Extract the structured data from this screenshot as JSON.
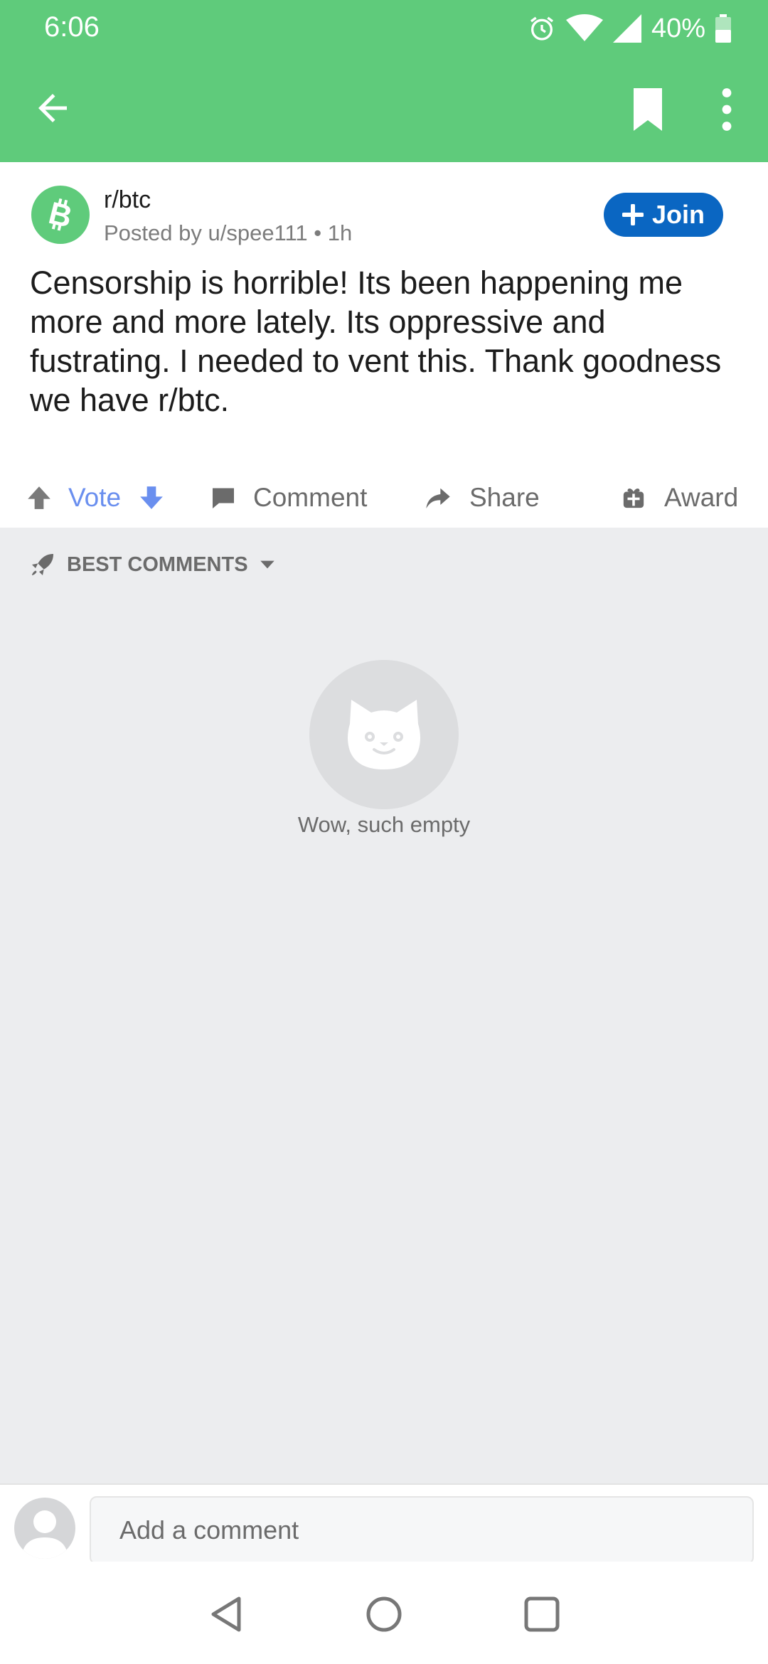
{
  "status_bar": {
    "time": "6:06",
    "battery": "40%",
    "icons": [
      "alarm-icon",
      "wifi-icon",
      "signal-icon",
      "battery-icon"
    ]
  },
  "app_bar": {
    "icons": [
      "back-arrow-icon",
      "bookmark-icon",
      "more-vert-icon"
    ],
    "color": "#5FCB7B"
  },
  "post": {
    "subreddit": "r/btc",
    "posted_by": "Posted by u/spee111 • 1h",
    "join_label": "Join",
    "body": "Censorship is horrible! Its been happening me more and more lately. Its oppressive and fustrating. I needed to vent this. Thank goodness we have r/btc.",
    "actions": {
      "vote_label": "Vote",
      "comment_label": "Comment",
      "share_label": "Share",
      "award_label": "Award"
    },
    "colors": {
      "join": "#0A66C2",
      "vote": "#6A8FEF"
    }
  },
  "comments": {
    "sort_label": "BEST COMMENTS",
    "empty_message": "Wow, such empty"
  },
  "comment_bar": {
    "placeholder": "Add a comment"
  }
}
